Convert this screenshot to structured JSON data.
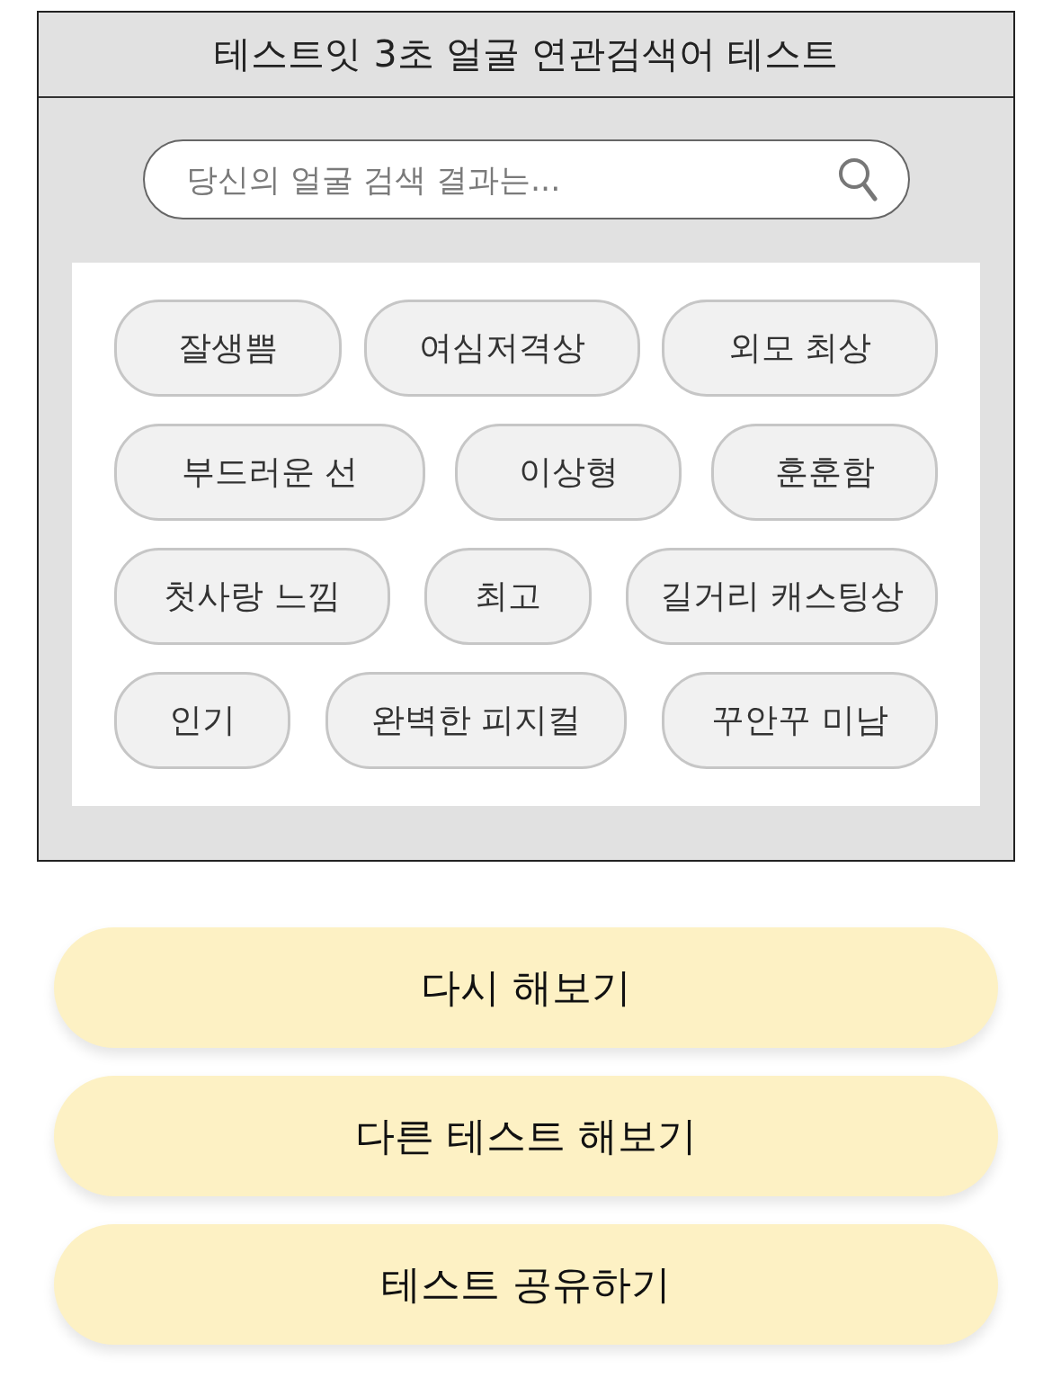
{
  "result_card": {
    "title": "테스트잇 3초 얼굴 연관검색어 테스트",
    "search": {
      "placeholder": "당신의 얼굴 검색 결과는..."
    },
    "tag_rows": [
      {
        "tags": [
          "잘생쁨",
          "여심저격상",
          "외모 최상"
        ]
      },
      {
        "tags": [
          "부드러운 선",
          "이상형",
          "훈훈함"
        ]
      },
      {
        "tags": [
          "첫사랑 느낌",
          "최고",
          "길거리 캐스팅상"
        ]
      },
      {
        "tags": [
          "인기",
          "완벽한 피지컬",
          "꾸안꾸 미남"
        ]
      }
    ]
  },
  "buttons": [
    "다시 해보기",
    "다른 테스트 해보기",
    "테스트 공유하기"
  ]
}
